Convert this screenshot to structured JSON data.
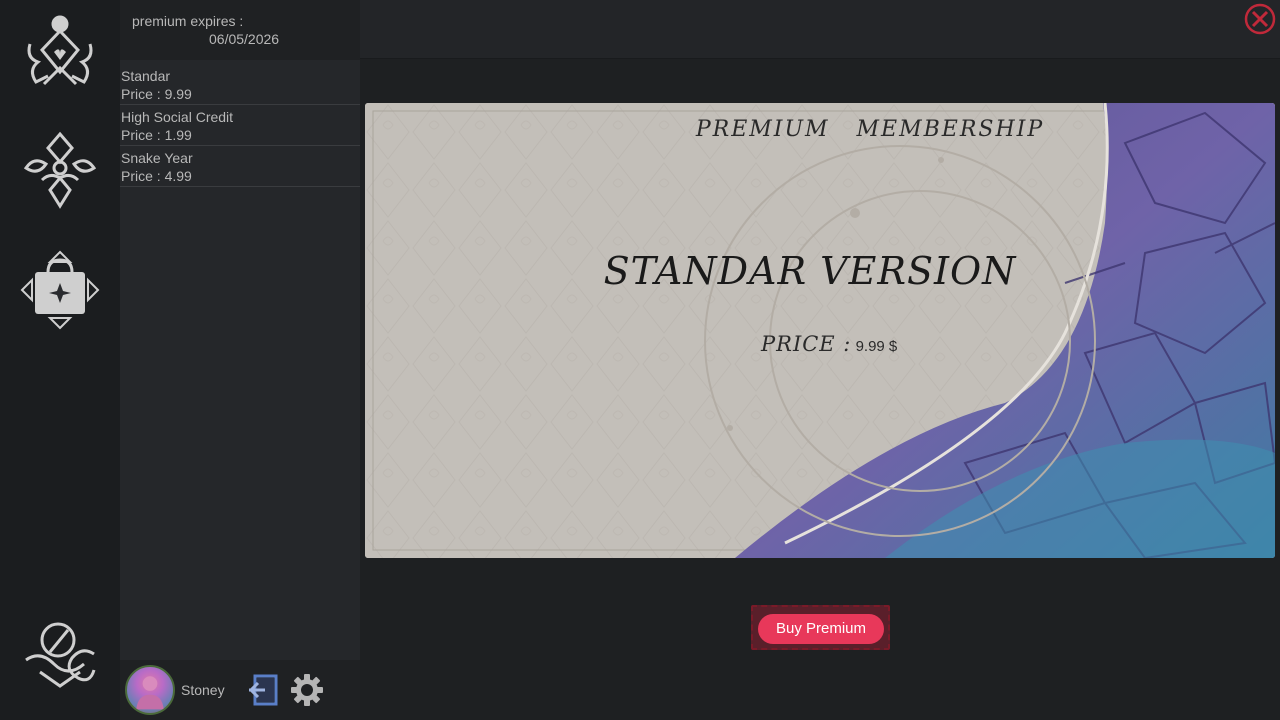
{
  "expiry": {
    "label": "premium expires :",
    "date": "06/05/2026"
  },
  "plans": [
    {
      "name": "Standar",
      "price": "Price : 9.99"
    },
    {
      "name": "High Social Credit",
      "price": "Price : 1.99"
    },
    {
      "name": "Snake Year",
      "price": "Price : 4.99"
    }
  ],
  "rail": {
    "icons": [
      "character-emblem-icon",
      "ornament-emblem-icon",
      "shop-bag-icon",
      "profile-emblem-icon"
    ]
  },
  "user": {
    "name": "Stoney"
  },
  "card": {
    "heading": "PREMIUM   MEMBERSHIP",
    "version": "STANDAR VERSION",
    "price_label": "PRICE :",
    "price_value": "9.99 $"
  },
  "actions": {
    "buy_label": "Buy Premium"
  },
  "colors": {
    "accent": "#e8385a",
    "close": "#c0293a",
    "card_bg": "#c1bdb7",
    "sidebar": "#1b1d1f"
  }
}
